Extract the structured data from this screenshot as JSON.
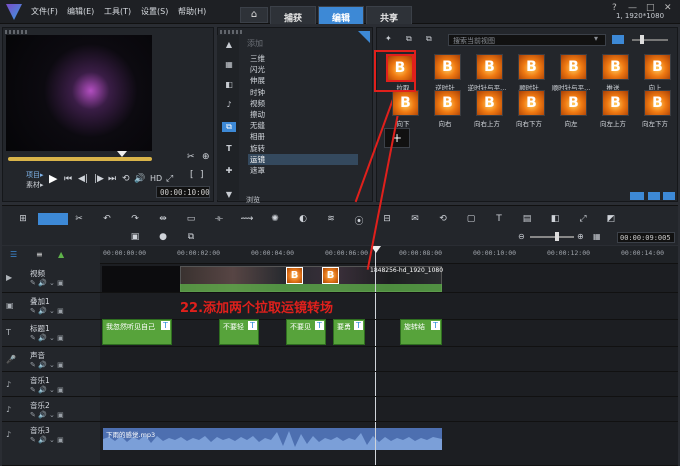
{
  "menu": {
    "file": "文件(F)",
    "edit": "编辑(E)",
    "tools": "工具(T)",
    "settings": "设置(S)",
    "help": "帮助(H)"
  },
  "tabs": {
    "capture": "捕获",
    "edit": "编辑",
    "share": "共享"
  },
  "window": {
    "resolution": "1, 1920*1080"
  },
  "preview": {
    "project_label": "项目▸",
    "clip_label": "素材▸",
    "hd": "HD",
    "timecode": "00:00:10:00"
  },
  "library": {
    "add_label": "添加",
    "items": [
      "三维",
      "闪光",
      "伸展",
      "时钟",
      "视频",
      "擦动",
      "无缝",
      "相册",
      "旋转",
      "运镜",
      "遮罩"
    ],
    "selected_index": 9,
    "browse_label": "浏览"
  },
  "thumbs": {
    "search_placeholder": "搜索当前视图",
    "row1": [
      "拉取",
      "逆时针",
      "逆时针与平...",
      "顺时针",
      "顺时针与平...",
      "推送",
      "向上"
    ],
    "row2": [
      "向下",
      "向右",
      "向右上方",
      "向右下方",
      "向左",
      "向左上方",
      "向左下方"
    ]
  },
  "toolbar": {
    "tc": "00:00:09:005"
  },
  "ruler": [
    "00:00:00:00",
    "00:00:02:00",
    "00:00:04:00",
    "00:00:06:00",
    "00:00:08:00",
    "00:00:10:00",
    "00:00:12:00",
    "00:00:14:00"
  ],
  "tracks": {
    "video": "视频",
    "overlay": "叠加1",
    "title": "标题1",
    "voice": "声音",
    "music1": "音乐1",
    "music2": "音乐2",
    "music3": "音乐3"
  },
  "clips": {
    "video_clip_name": "1848256-hd_1920_1080",
    "titles": [
      "我忽然听见自己",
      "不要轻",
      "不要见",
      "要勇",
      "旋转结"
    ],
    "audio_clip_name": "下雨的感觉.mp3"
  },
  "annotation": "22.添加两个拉取运镜转场",
  "colors": {
    "accent": "#3d89d6",
    "highlight": "#e0201c",
    "title_clip": "#57a33b",
    "audio_clip": "#4d6fb0"
  }
}
